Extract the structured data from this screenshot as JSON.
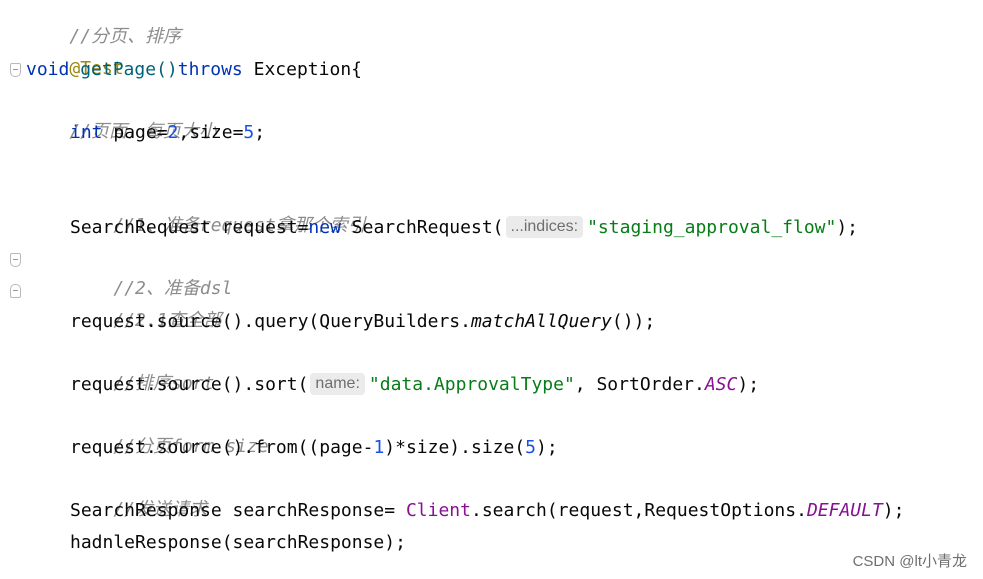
{
  "code": {
    "l1_comment": "//分页、排序",
    "l2_annotation": "@Test",
    "l3": {
      "kw_void": "void",
      "method": "getPage",
      "paren": "()",
      "kw_throws": "throws",
      "rest": " Exception{"
    },
    "l4_comment": "//页面，每页大小",
    "l5": {
      "kw_int": "int",
      "t1": " page=",
      "n1": "2",
      "t2": ",size=",
      "n2": "5",
      "t3": ";"
    },
    "l7_comment": "//1、准备request拿那个索引",
    "l8": {
      "t1": "SearchRequest request=",
      "kw_new": "new",
      "t2": " SearchRequest(",
      "hint": "...indices:",
      "str": "\"staging_approval_flow\"",
      "t3": ");"
    },
    "l9_comment": "//2、准备dsl",
    "l10_comment": "//2.1查全部",
    "l11": {
      "t1": "request.source().query(QueryBuilders.",
      "static_call": "matchAllQuery",
      "t2": "());"
    },
    "l12_comment": "//排序sort",
    "l13": {
      "t1": "request.source().sort(",
      "hint": "name:",
      "str": "\"data.ApprovalType\"",
      "t2": ", SortOrder.",
      "const": "ASC",
      "t3": ");"
    },
    "l14_comment": "//分页form size",
    "l15": {
      "t1": "request.source().from((page-",
      "n1": "1",
      "t2": ")*size).size(",
      "n2": "5",
      "t3": ");"
    },
    "l16_comment": "//发送请求",
    "l17": {
      "t1": "SearchResponse searchResponse= ",
      "cls": "Client",
      "t2": ".search(request,RequestOptions.",
      "const": "DEFAULT",
      "t3": ");"
    },
    "l18": {
      "t1": "hadnleResponse(searchResponse);"
    }
  },
  "watermark": "CSDN @lt小青龙",
  "colors": {
    "comment": "#8c8c8c",
    "annotation": "#9e880d",
    "keyword": "#0033b3",
    "method": "#00627a",
    "number": "#1750eb",
    "string": "#067d17",
    "static_field": "#871094"
  },
  "icons": [
    "fold-start-icon",
    "fold-end-icon"
  ]
}
